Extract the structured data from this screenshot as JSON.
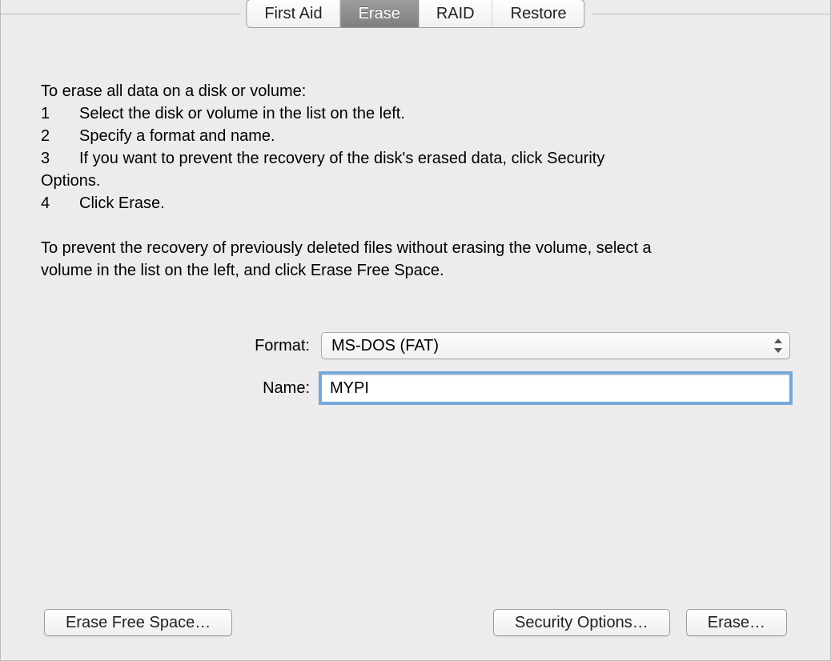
{
  "tabs": {
    "first_aid": "First Aid",
    "erase": "Erase",
    "raid": "RAID",
    "restore": "Restore"
  },
  "instructions": {
    "intro": "To erase all data on a disk or volume:",
    "step1_num": "1",
    "step1": "Select the disk or volume in the list on the left.",
    "step2_num": "2",
    "step2": "Specify a format and name.",
    "step3_num": "3",
    "step3": "If you want to prevent the recovery of the disk's erased data, click Security",
    "step3b": "Options.",
    "step4_num": "4",
    "step4": "Click Erase.",
    "para2a": "To prevent the recovery of previously deleted files without erasing the volume, select a",
    "para2b": "volume in the list on the left, and click Erase Free Space."
  },
  "form": {
    "format_label": "Format:",
    "format_value": "MS-DOS (FAT)",
    "name_label": "Name:",
    "name_value": "MYPI"
  },
  "buttons": {
    "erase_free_space": "Erase Free Space…",
    "security_options": "Security Options…",
    "erase": "Erase…"
  }
}
